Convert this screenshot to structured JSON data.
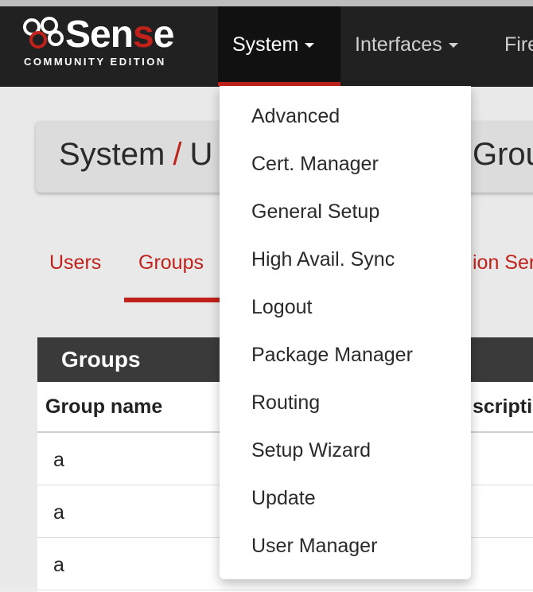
{
  "brand": {
    "word_a": "Sen",
    "word_b": "s",
    "word_c": "e",
    "subtitle": "COMMUNITY EDITION"
  },
  "navbar": {
    "items": [
      {
        "label": "System"
      },
      {
        "label": "Interfaces"
      },
      {
        "label": "Fire"
      }
    ]
  },
  "breadcrumb": {
    "part1": "System",
    "separator": "/",
    "part2_partial": "U",
    "part3_partial": "Grou"
  },
  "tabs": [
    {
      "label": "Users"
    },
    {
      "label": "Groups"
    },
    {
      "label": "ion Ser"
    }
  ],
  "table": {
    "title": "Groups",
    "columns": {
      "name": "Group name",
      "description_partial": "scriptio"
    },
    "rows": [
      {
        "name": "a"
      },
      {
        "name": "a"
      },
      {
        "name": "a"
      }
    ]
  },
  "dropdown": {
    "items": [
      "Advanced",
      "Cert. Manager",
      "General Setup",
      "High Avail. Sync",
      "Logout",
      "Package Manager",
      "Routing",
      "Setup Wizard",
      "Update",
      "User Manager"
    ]
  },
  "colors": {
    "accent": "#c0211a",
    "navbar": "#212121",
    "table_header": "#3a3a3a"
  }
}
